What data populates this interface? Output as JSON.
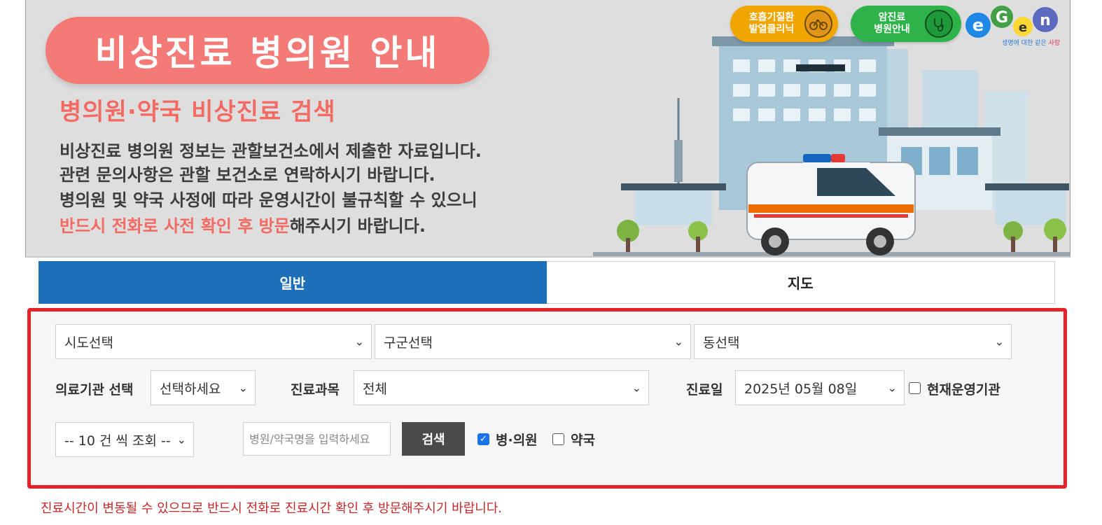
{
  "banner": {
    "title": "비상진료 병의원 안내",
    "subtitle": "병의원·약국 비상진료 검색",
    "desc_line1": "비상진료 병의원 정보는 관할보건소에서 제출한 자료입니다.",
    "desc_line2": "관련 문의사항은 관할 보건소로 연락하시기 바랍니다.",
    "desc_line3": "병의원 및 약국 사정에 따라 운영시간이 불규칙할 수 있으니",
    "desc_line4_highlight": "반드시 전화로 사전 확인 후 방문",
    "desc_line4_rest": "해주시기 바랍니다.",
    "badge_respiratory_line1": "호흡기질환",
    "badge_respiratory_line2": "발열클리닉",
    "badge_cancer_line1": "암진료",
    "badge_cancer_line2": "병원안내",
    "logo_tagline_a": "생명에 대한 같은 ",
    "logo_tagline_b": "사랑"
  },
  "tabs": {
    "general": "일반",
    "map": "지도"
  },
  "search": {
    "sido": "시도선택",
    "gugun": "구군선택",
    "dong": "동선택",
    "institution_label": "의료기관 선택",
    "institution_value": "선택하세요",
    "department_label": "진료과목",
    "department_value": "전체",
    "date_label": "진료일",
    "date_value": "2025년 05월 08일",
    "open_now_label": "현재운영기관",
    "page_size": "-- 10 건 씩 조회 --",
    "name_placeholder": "병원/약국명을 입력하세요",
    "search_button": "검색",
    "hospital_label": "병·의원",
    "pharmacy_label": "약국"
  },
  "state": {
    "hospital_checked": true,
    "pharmacy_checked": false,
    "open_now_checked": false
  },
  "colors": {
    "accent_blue": "#1e6fba",
    "highlight_red": "#e3222a",
    "banner_pink": "#f47a78"
  },
  "notice": "진료시간이 변동될 수 있으므로 반드시 전화로 진료시간 확인 후 방문해주시기 바랍니다."
}
